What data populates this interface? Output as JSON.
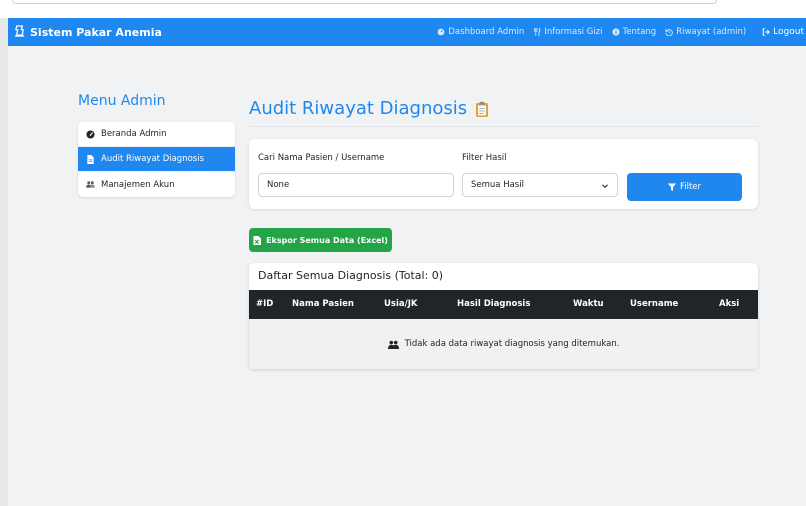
{
  "navbar": {
    "brand": "Sistem Pakar Anemia",
    "links": [
      {
        "label": "Dashboard Admin",
        "icon": "dashboard-icon"
      },
      {
        "label": "Informasi Gizi",
        "icon": "utensils-icon"
      },
      {
        "label": "Tentang",
        "icon": "info-icon"
      },
      {
        "label": "Riwayat (admin)",
        "icon": "history-icon"
      }
    ],
    "logout": "Logout"
  },
  "sidebar": {
    "title": "Menu Admin",
    "items": [
      {
        "label": "Beranda Admin",
        "icon": "dashboard-icon",
        "active": false
      },
      {
        "label": "Audit Riwayat Diagnosis",
        "icon": "file-icon",
        "active": true
      },
      {
        "label": "Manajemen Akun",
        "icon": "users-icon",
        "active": false
      }
    ]
  },
  "main": {
    "title": "Audit Riwayat Diagnosis",
    "title_icon": "clipboard-icon",
    "filter": {
      "search_label": "Cari Nama Pasien / Username",
      "search_value": "None",
      "result_label": "Filter Hasil",
      "result_selected": "Semua Hasil",
      "button_label": "Filter"
    },
    "export_button": "Ekspor Semua Data (Excel)",
    "table": {
      "title": "Daftar Semua Diagnosis (Total: 0)",
      "columns": [
        "#ID",
        "Nama Pasien",
        "Usia/JK",
        "Hasil Diagnosis",
        "Waktu",
        "Username",
        "Aksi"
      ],
      "empty_message": "Tidak ada data riwayat diagnosis yang ditemukan."
    }
  },
  "colors": {
    "primary": "#1e88f0",
    "success": "#22a447",
    "table_header": "#212529",
    "page_background": "#f1f2f4"
  }
}
